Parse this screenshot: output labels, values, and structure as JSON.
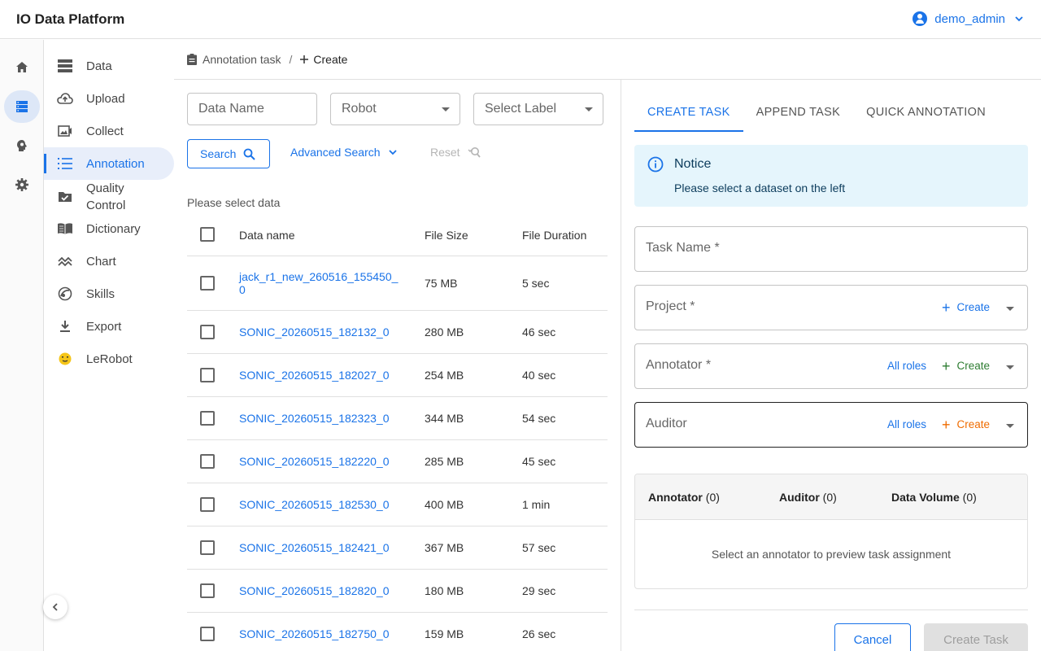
{
  "app": {
    "title": "IO Data Platform",
    "user": "demo_admin"
  },
  "colors": {
    "accent": "#1a73e8",
    "green": "#2e7d32",
    "orange": "#ef6c00"
  },
  "rail": {
    "icons": [
      "home-icon",
      "database-icon",
      "brain-icon",
      "gear-icon"
    ],
    "active": "database-icon"
  },
  "sidenav": {
    "items": [
      {
        "label": "Data",
        "icon": "storage-icon"
      },
      {
        "label": "Upload",
        "icon": "cloud-upload-icon"
      },
      {
        "label": "Collect",
        "icon": "image-icon"
      },
      {
        "label": "Annotation",
        "icon": "list-icon"
      },
      {
        "label": "Quality Control",
        "icon": "checkbox-folder-icon"
      },
      {
        "label": "Dictionary",
        "icon": "book-icon"
      },
      {
        "label": "Chart",
        "icon": "chart-icon"
      },
      {
        "label": "Skills",
        "icon": "skills-icon"
      },
      {
        "label": "Export",
        "icon": "download-icon"
      },
      {
        "label": "LeRobot",
        "icon": "emoji-icon"
      }
    ],
    "active": "Annotation"
  },
  "breadcrumb": {
    "parent": "Annotation task",
    "separator": "/",
    "current": "Create"
  },
  "filters": {
    "data_name_placeholder": "Data Name",
    "robot_placeholder": "Robot",
    "label_placeholder": "Select Label",
    "search_label": "Search",
    "advanced_search_label": "Advanced Search",
    "reset_label": "Reset"
  },
  "table": {
    "hint": "Please select data",
    "headers": {
      "name": "Data name",
      "size": "File Size",
      "duration": "File Duration"
    },
    "rows": [
      {
        "name": "jack_r1_new_260516_155450_0",
        "size": "75 MB",
        "duration": "5 sec"
      },
      {
        "name": "SONIC_20260515_182132_0",
        "size": "280 MB",
        "duration": "46 sec"
      },
      {
        "name": "SONIC_20260515_182027_0",
        "size": "254 MB",
        "duration": "40 sec"
      },
      {
        "name": "SONIC_20260515_182323_0",
        "size": "344 MB",
        "duration": "54 sec"
      },
      {
        "name": "SONIC_20260515_182220_0",
        "size": "285 MB",
        "duration": "45 sec"
      },
      {
        "name": "SONIC_20260515_182530_0",
        "size": "400 MB",
        "duration": "1 min"
      },
      {
        "name": "SONIC_20260515_182421_0",
        "size": "367 MB",
        "duration": "57 sec"
      },
      {
        "name": "SONIC_20260515_182820_0",
        "size": "180 MB",
        "duration": "29 sec"
      },
      {
        "name": "SONIC_20260515_182750_0",
        "size": "159 MB",
        "duration": "26 sec"
      }
    ]
  },
  "tabs": [
    "CREATE TASK",
    "APPEND TASK",
    "QUICK ANNOTATION"
  ],
  "notice": {
    "title": "Notice",
    "message": "Please select a dataset on the left"
  },
  "form": {
    "task_name": "Task Name *",
    "project": "Project *",
    "annotator": "Annotator *",
    "auditor": "Auditor",
    "all_roles": "All roles",
    "create": "Create"
  },
  "preview": {
    "annotator": "Annotator",
    "annotator_count": "(0)",
    "auditor": "Auditor",
    "auditor_count": "(0)",
    "volume": "Data Volume",
    "volume_count": "(0)",
    "empty": "Select an annotator to preview task assignment"
  },
  "actions": {
    "cancel": "Cancel",
    "create_task": "Create Task"
  }
}
